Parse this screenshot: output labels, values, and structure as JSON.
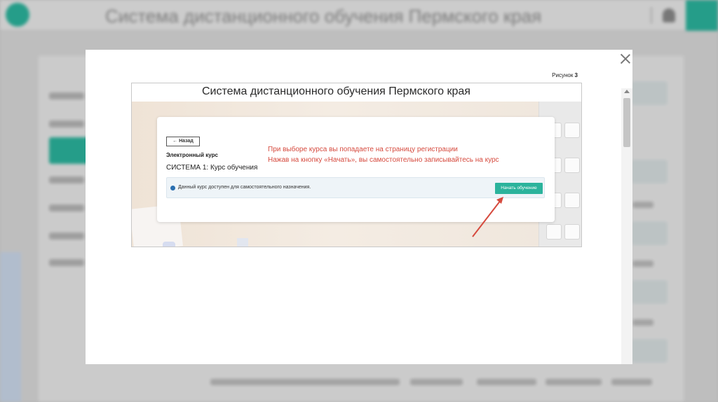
{
  "background": {
    "title": "Система дистанционного обучения Пермского края",
    "accent": "#2bb39c"
  },
  "modal": {
    "close_icon": "close-icon",
    "caption_label": "Рисунок",
    "caption_number": "3"
  },
  "screenshot": {
    "title": "Система дистанционного обучения Пермского края",
    "back_label": "← Назад",
    "course_type": "Электронный курс",
    "course_name": "СИСТЕМА 1: Курс обучения",
    "info_text": "Данный курс доступен для самостоятельного назначения.",
    "start_label": "Начать обучение",
    "note_line1": "При выборе курса вы попадаете на страницу регистрации",
    "note_line2": "Нажав на кнопку «Начать», вы самостоятельно записывайтесь на курс",
    "annotation_color": "#d64a3e",
    "button_color": "#2bb39c"
  }
}
